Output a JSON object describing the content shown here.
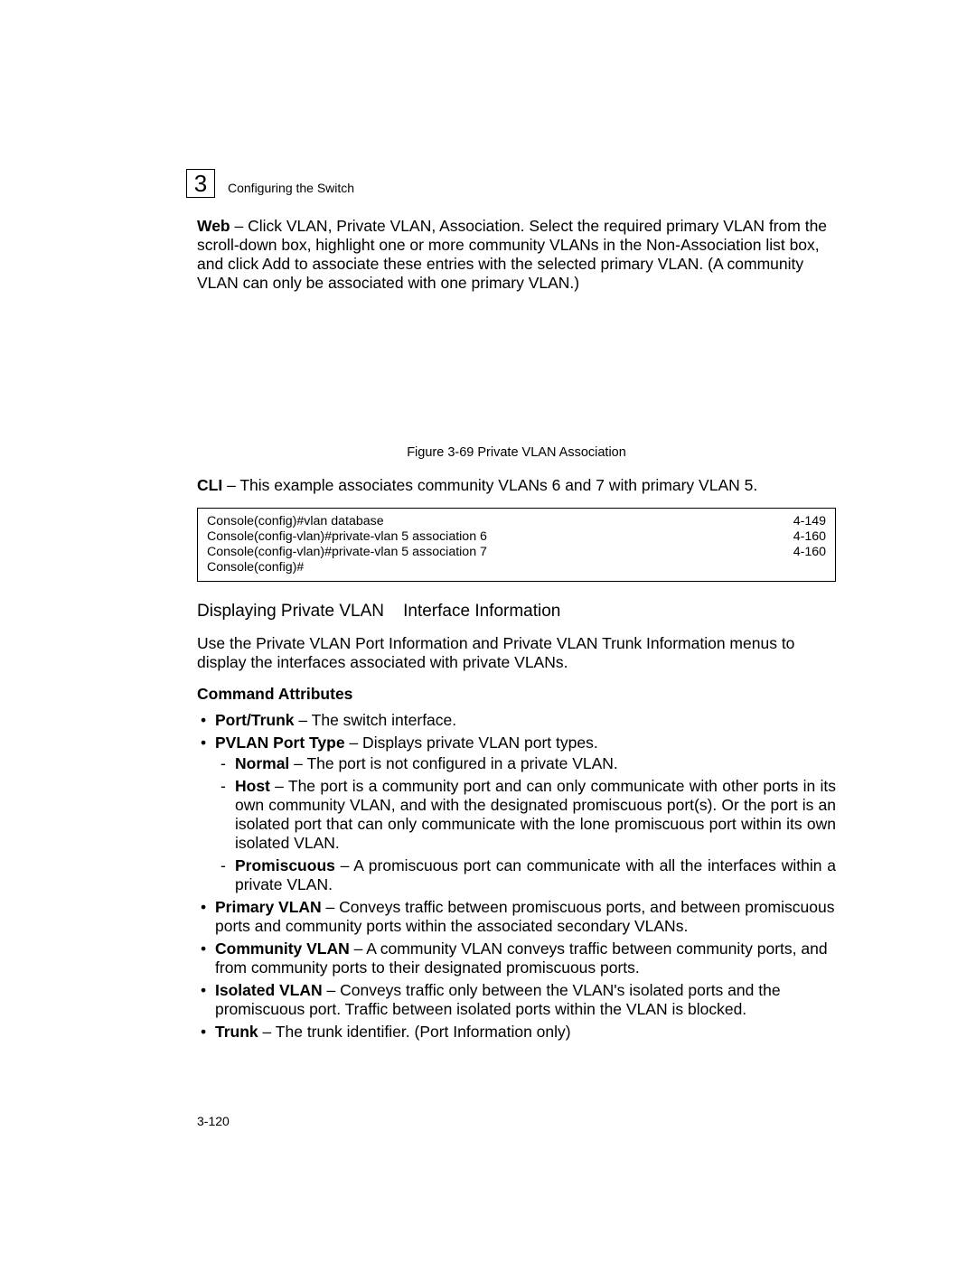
{
  "chapter_number": "3",
  "running_head": "Configuring the Switch",
  "web_para_prefix": "Web",
  "web_para": " – Click VLAN, Private VLAN, Association. Select the required primary VLAN from the scroll-down box, highlight one or more community VLANs in the Non-Association list box, and click Add to associate these entries with the selected primary VLAN. (A community VLAN can only be associated with one primary VLAN.)",
  "figure_caption": "Figure 3-69  Private VLAN Association",
  "cli_para_prefix": "CLI",
  "cli_para": " – This example associates community VLANs 6 and 7 with primary VLAN 5.",
  "cli_rows": [
    {
      "cmd": "Console(config)#vlan database",
      "ref": "4-149"
    },
    {
      "cmd": "Console(config-vlan)#private-vlan 5 association 6",
      "ref": "4-160"
    },
    {
      "cmd": "Console(config-vlan)#private-vlan 5 association 7",
      "ref": "4-160"
    },
    {
      "cmd": "Console(config)#",
      "ref": ""
    }
  ],
  "subheading_a": "Displaying Private VLAN",
  "subheading_b": "Interface Information",
  "use_para": "Use the Private VLAN Port Information and Private VLAN Trunk Information menus to display the interfaces associated with private VLANs.",
  "cmd_attr_heading": "Command Attributes",
  "attrs": {
    "port_trunk_b": "Port/Trunk",
    "port_trunk_t": " – The switch interface.",
    "pvlan_type_b": "PVLAN Port Type",
    "pvlan_type_t": " – Displays private VLAN port types.",
    "normal_b": "Normal",
    "normal_t": " – The port is not configured in a private VLAN.",
    "host_b": "Host",
    "host_t": " – The port is a community port and can only communicate with other ports in its own community VLAN, and with the designated promiscuous port(s). Or the port is an isolated port that can only communicate with the lone promiscuous port within its own isolated VLAN.",
    "prom_b": "Promiscuous",
    "prom_t": " – A promiscuous port can communicate with all the interfaces within a private VLAN.",
    "primary_b": "Primary VLAN",
    "primary_t": " – Conveys traffic between promiscuous ports, and between promiscuous ports and community ports within the associated secondary VLANs.",
    "community_b": "Community VLAN",
    "community_t": " – A community VLAN conveys traffic between community ports, and from community ports to their designated promiscuous ports.",
    "isolated_b": "Isolated VLAN",
    "isolated_t": " –  Conveys traffic only between the VLAN's isolated ports and the promiscuous port. Traffic between isolated ports within the VLAN is blocked.",
    "trunk_b": "Trunk",
    "trunk_t": " – The trunk identifier. (Port Information only)"
  },
  "page_number": "3-120"
}
